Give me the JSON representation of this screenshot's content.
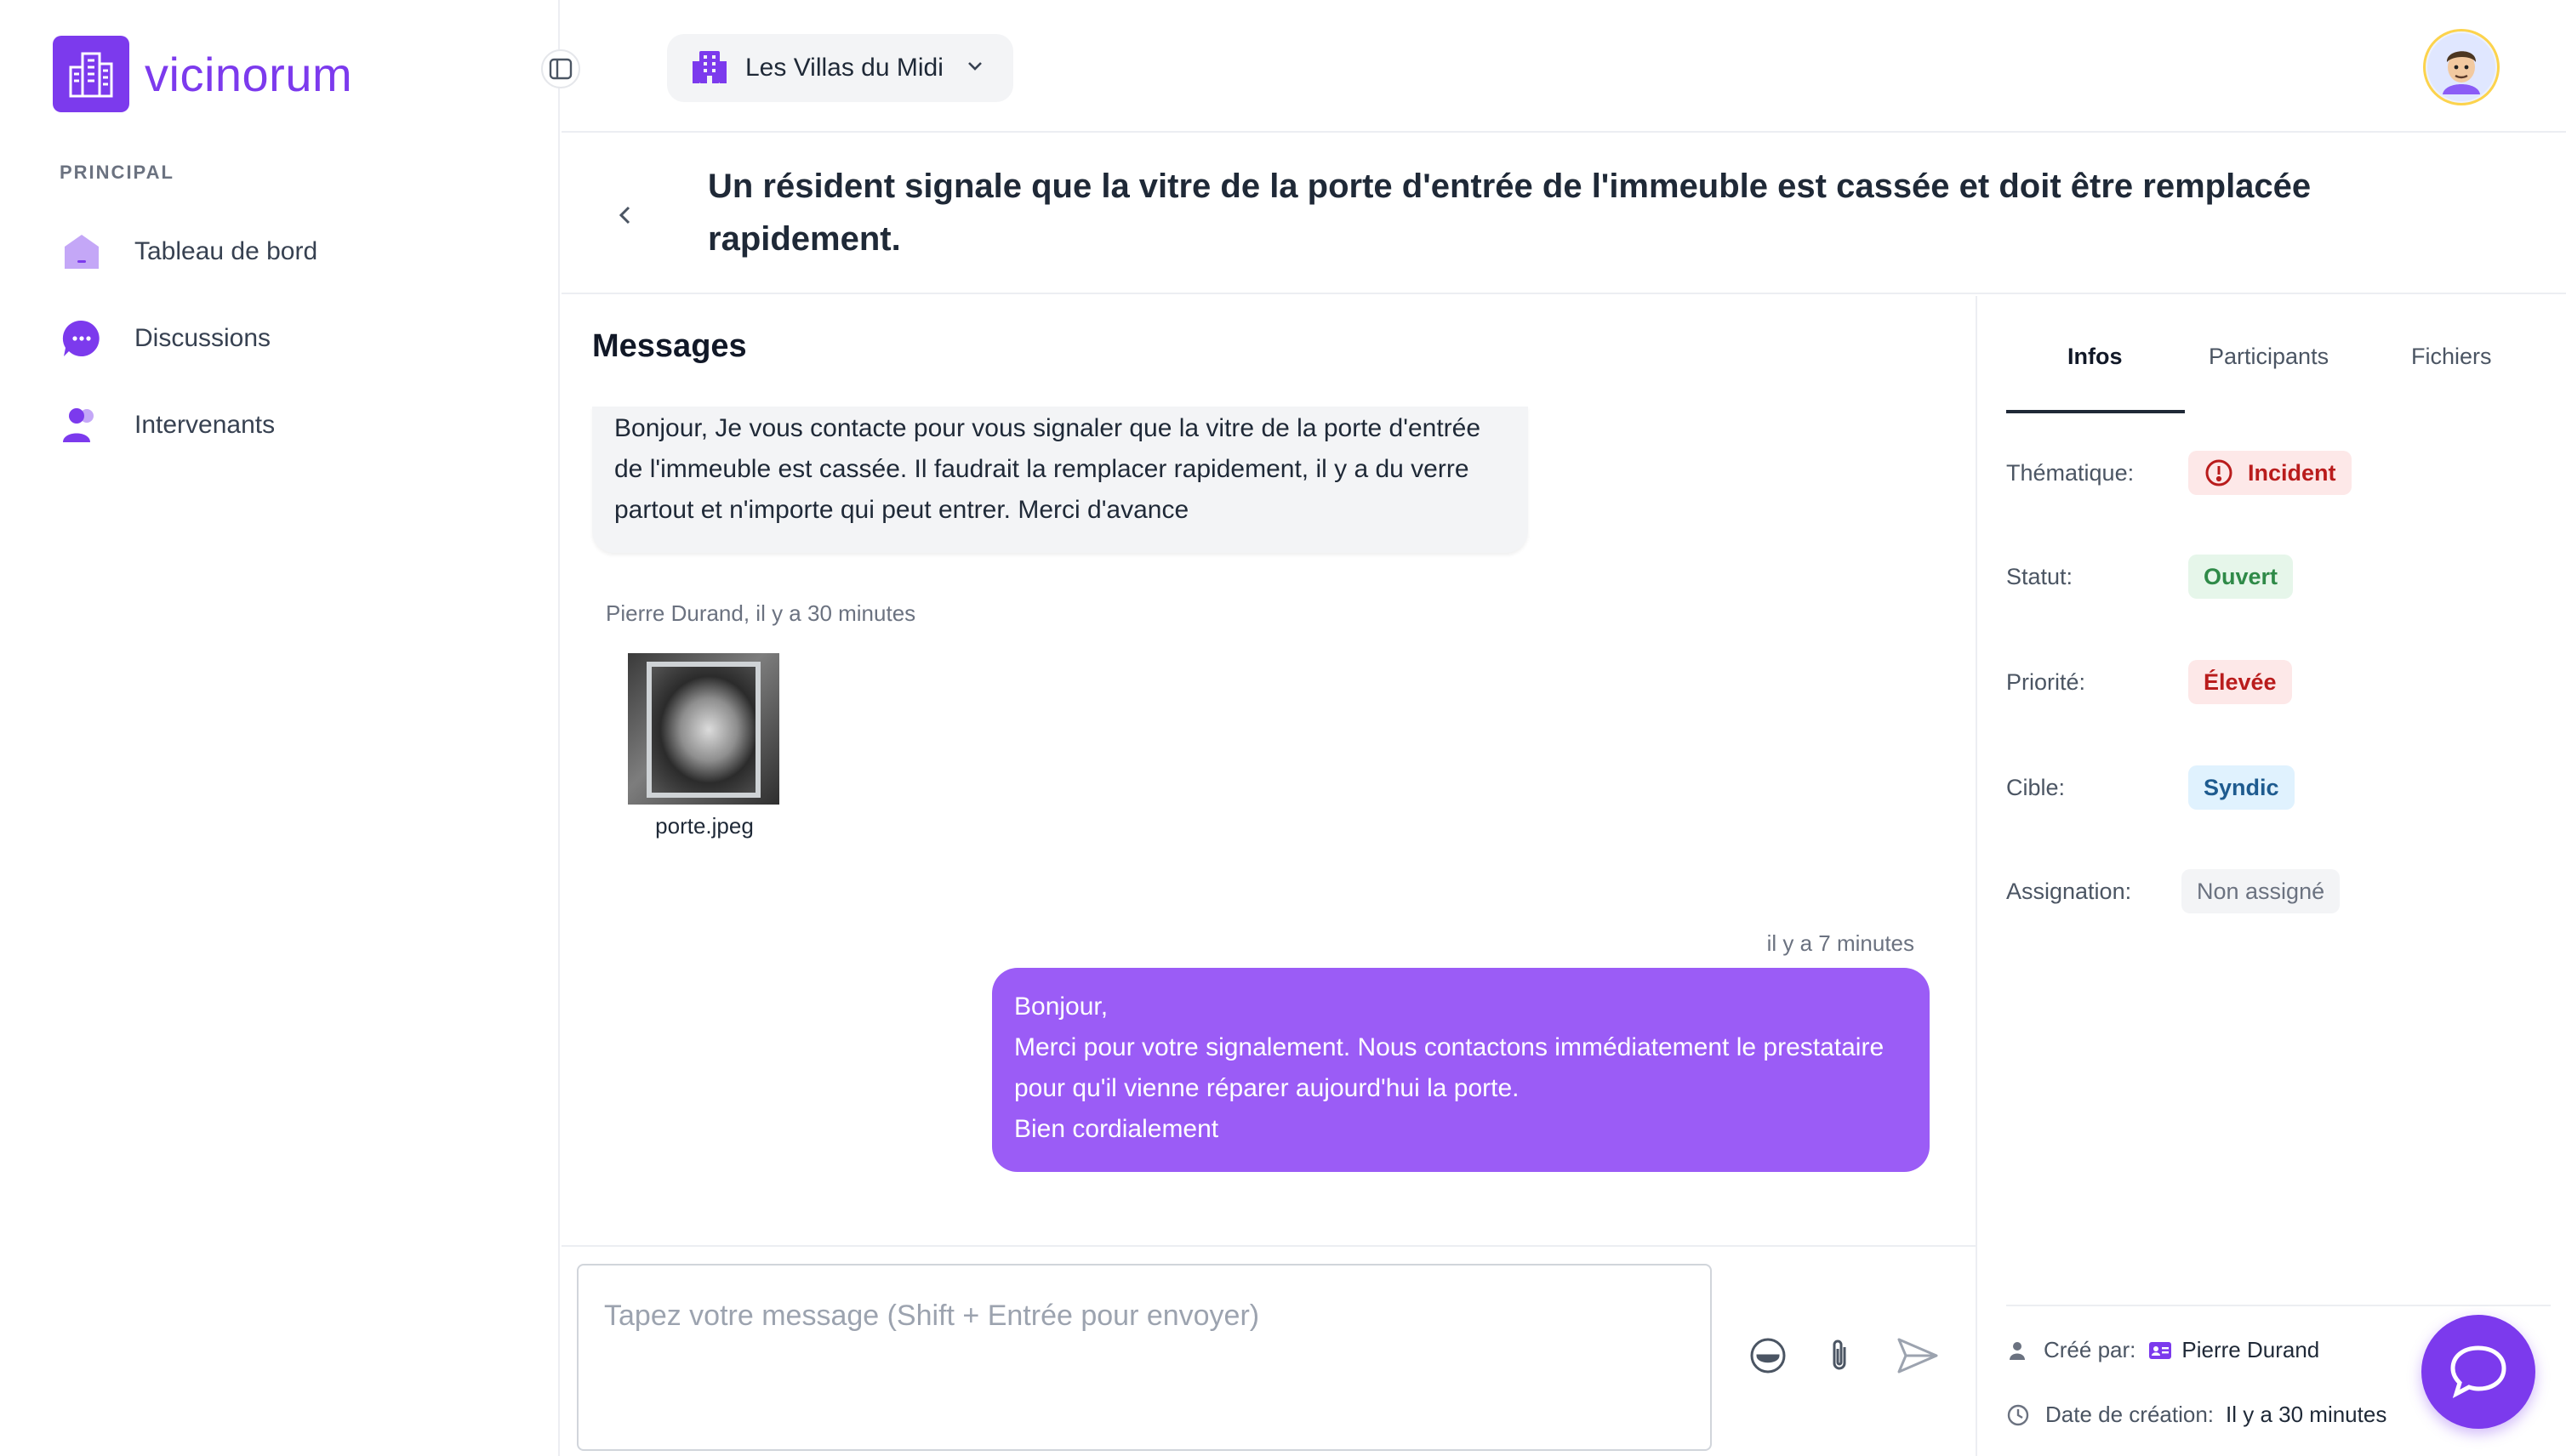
{
  "app": {
    "name": "vicinorum",
    "brand_color": "#7c3aed"
  },
  "sidebar": {
    "section_label": "PRINCIPAL",
    "items": [
      {
        "label": "Tableau de bord",
        "icon": "home-icon"
      },
      {
        "label": "Discussions",
        "icon": "chat-dots-icon"
      },
      {
        "label": "Intervenants",
        "icon": "users-icon"
      }
    ]
  },
  "topbar": {
    "building": "Les Villas du Midi"
  },
  "ticket": {
    "title": "Un résident signale que la vitre de la porte d'entrée de l'immeuble est cassée et doit être remplacée rapidement."
  },
  "messages": {
    "heading": "Messages",
    "incoming": {
      "text": "Bonjour, Je vous contacte pour vous signaler que la vitre de la porte d'entrée de l'immeuble est cassée. Il faudrait la remplacer rapidement, il y a du verre partout et n'importe qui peut entrer. Merci d'avance",
      "meta": "Pierre Durand, il y a 30 minutes",
      "attachment_name": "porte.jpeg"
    },
    "outgoing": {
      "meta": "il y a 7 minutes",
      "lines": [
        "Bonjour,",
        "Merci pour votre signalement. Nous contactons immédiatement le prestataire pour qu'il vienne réparer aujourd'hui la porte.",
        "Bien cordialement"
      ]
    }
  },
  "composer": {
    "placeholder": "Tapez votre message (Shift + Entrée pour envoyer)"
  },
  "panel": {
    "tabs": [
      "Infos",
      "Participants",
      "Fichiers"
    ],
    "rows": [
      {
        "label": "Thématique:",
        "value": "Incident"
      },
      {
        "label": "Statut:",
        "value": "Ouvert"
      },
      {
        "label": "Priorité:",
        "value": "Élevée"
      },
      {
        "label": "Cible:",
        "value": "Syndic"
      },
      {
        "label": "Assignation:",
        "value": "Non assigné"
      }
    ],
    "created_by_label": "Créé par:",
    "created_by_value": "Pierre Durand",
    "created_at_label": "Date de création:",
    "created_at_value": "Il y a 30 minutes"
  }
}
